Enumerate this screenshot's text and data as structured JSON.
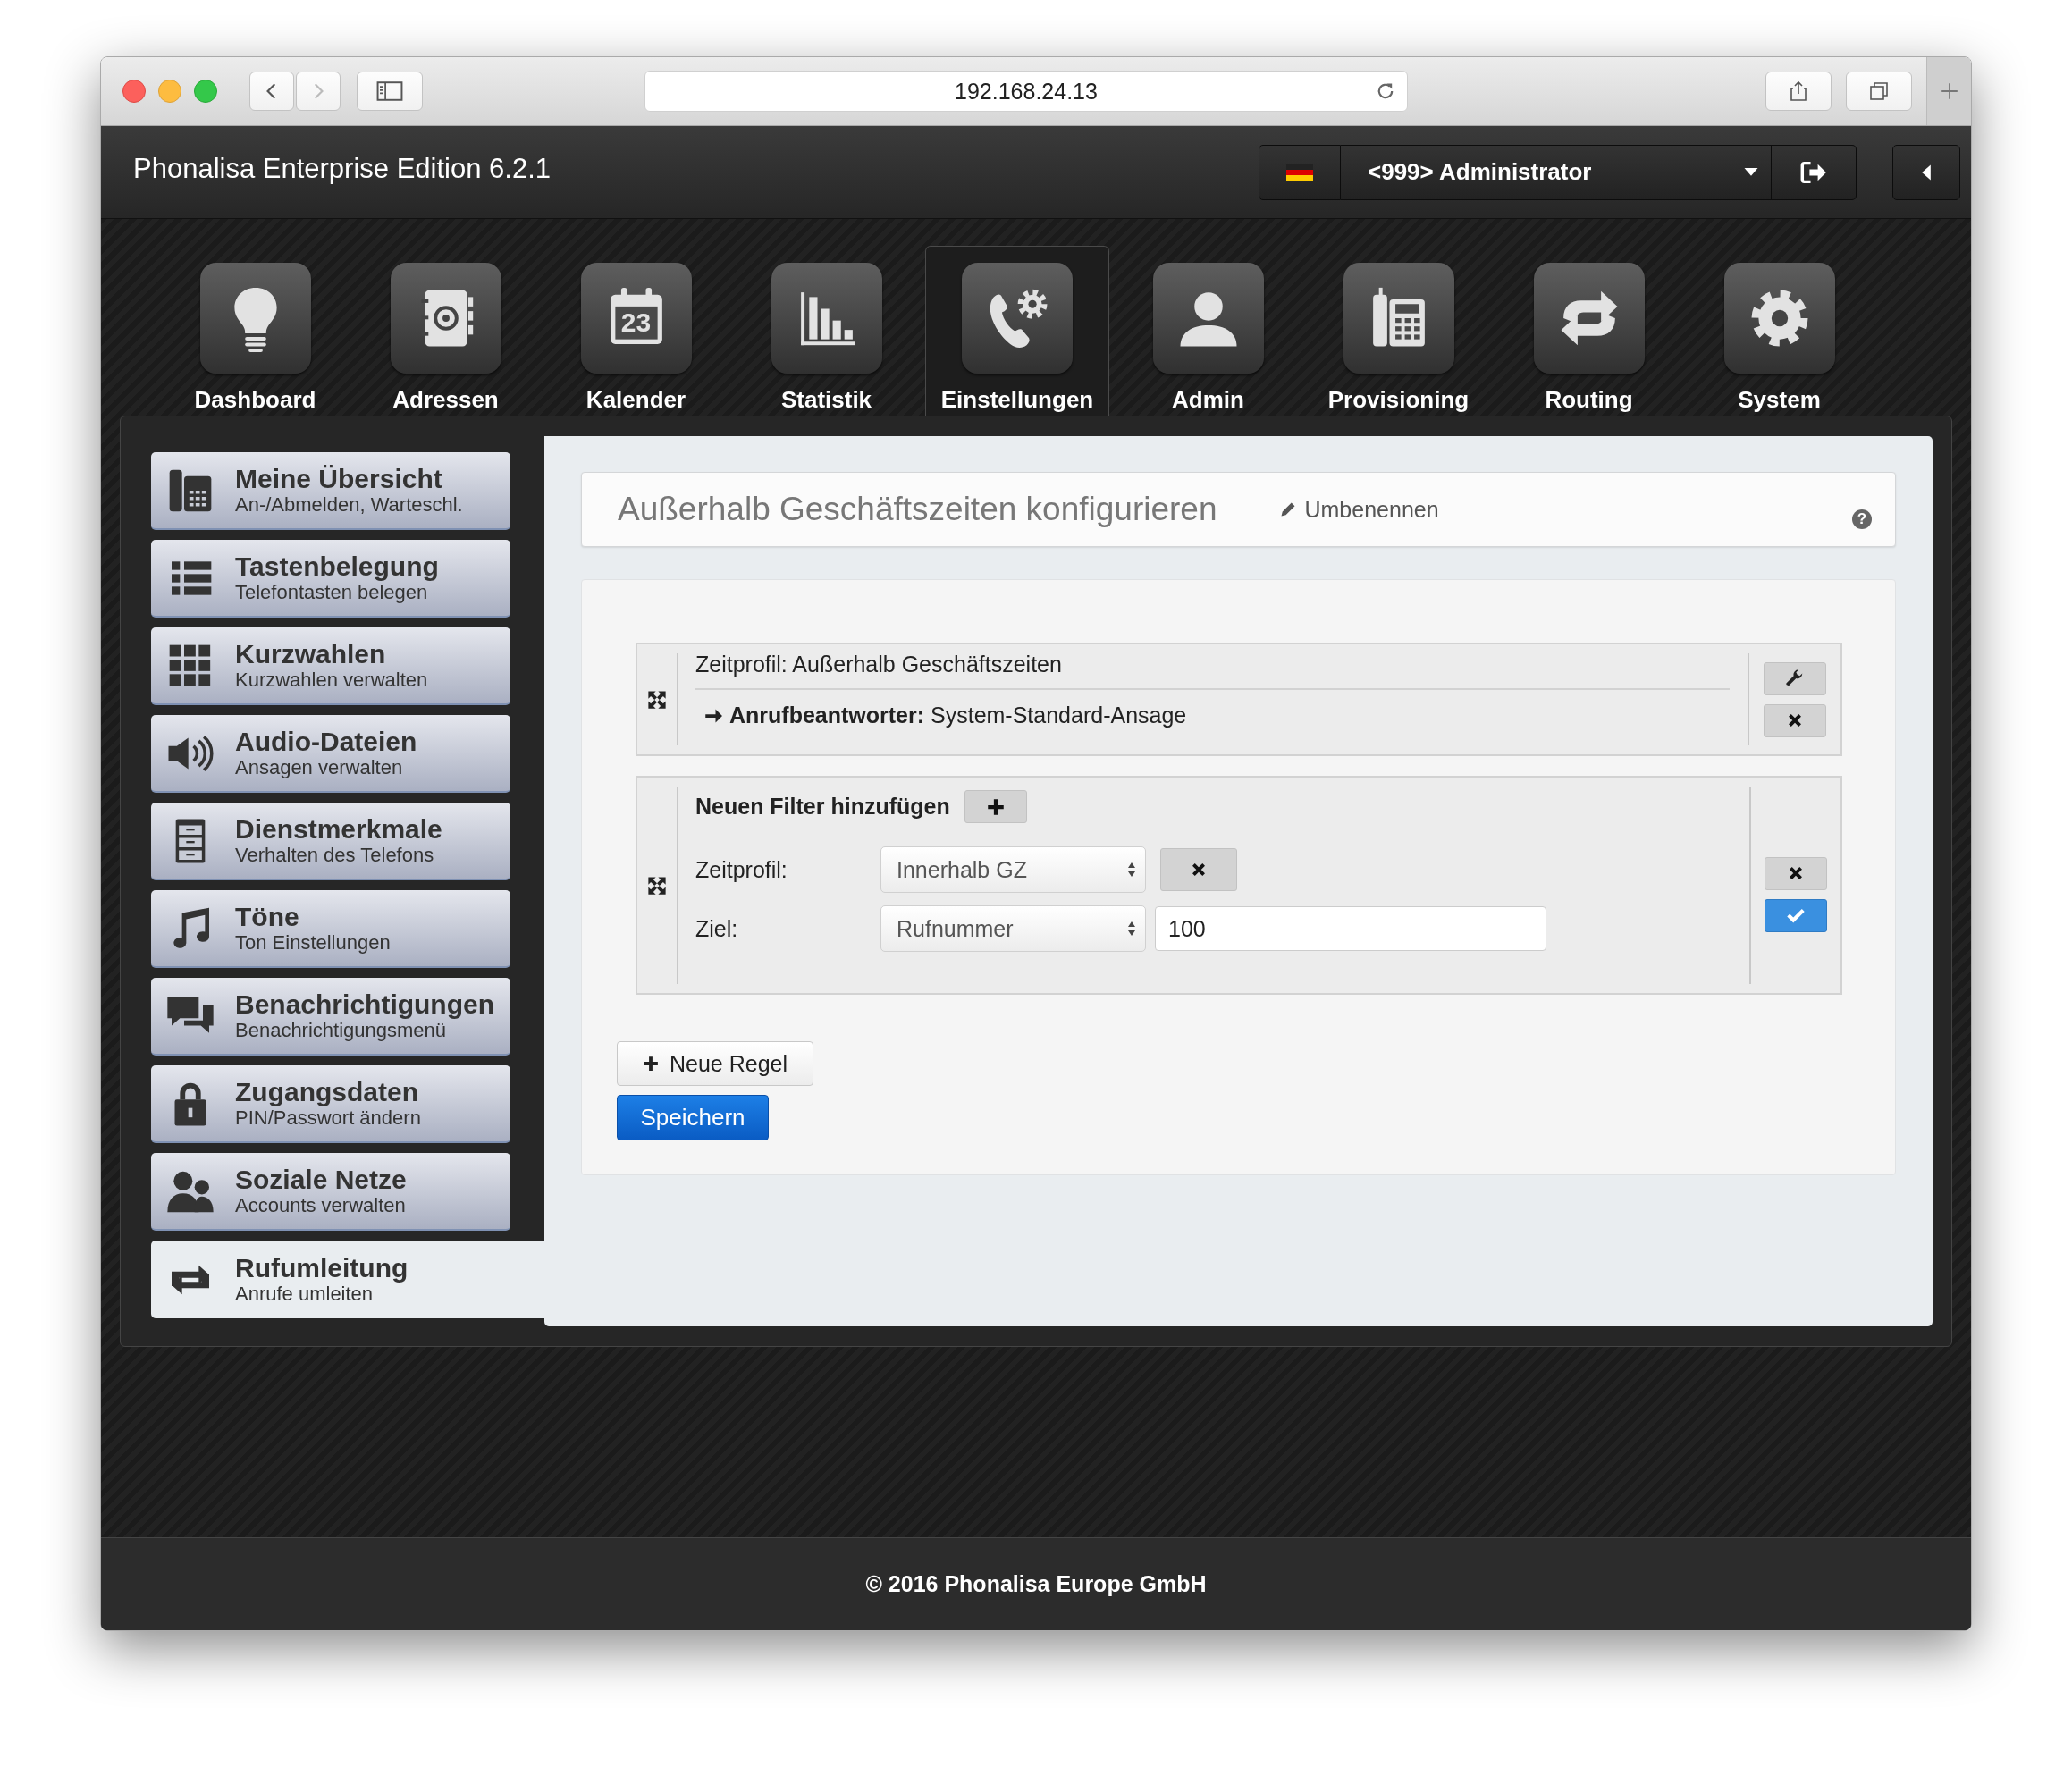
{
  "browser": {
    "url": "192.168.24.13"
  },
  "header": {
    "title": "Phonalisa Enterprise Edition 6.2.1",
    "user": "<999> Administrator"
  },
  "nav": [
    {
      "label": "Dashboard",
      "selected": false
    },
    {
      "label": "Adressen",
      "selected": false
    },
    {
      "label": "Kalender",
      "selected": false,
      "icon_text": "23"
    },
    {
      "label": "Statistik",
      "selected": false
    },
    {
      "label": "Einstellungen",
      "selected": true
    },
    {
      "label": "Admin",
      "selected": false
    },
    {
      "label": "Provisioning",
      "selected": false
    },
    {
      "label": "Routing",
      "selected": false
    },
    {
      "label": "System",
      "selected": false
    }
  ],
  "sidebar": [
    {
      "title": "Meine Übersicht",
      "subtitle": "An-/Abmelden, Warteschl.",
      "selected": false
    },
    {
      "title": "Tastenbelegung",
      "subtitle": "Telefontasten belegen",
      "selected": false
    },
    {
      "title": "Kurzwahlen",
      "subtitle": "Kurzwahlen verwalten",
      "selected": false
    },
    {
      "title": "Audio-Dateien",
      "subtitle": "Ansagen verwalten",
      "selected": false
    },
    {
      "title": "Dienstmerkmale",
      "subtitle": "Verhalten des Telefons",
      "selected": false
    },
    {
      "title": "Töne",
      "subtitle": "Ton Einstellungen",
      "selected": false
    },
    {
      "title": "Benachrichtigungen",
      "subtitle": "Benachrichtigungsmenü",
      "selected": false
    },
    {
      "title": "Zugangsdaten",
      "subtitle": "PIN/Passwort ändern",
      "selected": false
    },
    {
      "title": "Soziale Netze",
      "subtitle": "Accounts verwalten",
      "selected": false
    },
    {
      "title": "Rufumleitung",
      "subtitle": "Anrufe umleiten",
      "selected": true
    }
  ],
  "panel": {
    "title": "Außerhalb Geschäftszeiten konfigurieren",
    "rename": "Umbenennen",
    "help": "?"
  },
  "rule": {
    "profile": "Zeitprofil: Außerhalb Geschäftszeiten",
    "action": "**Anrufbeantworter:** System-Standard-Ansage"
  },
  "filter": {
    "title": "Neuen Filter hinzufügen",
    "fields": [
      {
        "kind": "select_remove",
        "label": "Zeitprofil:",
        "select": "Innerhalb GZ"
      },
      {
        "kind": "select_input",
        "label": "Ziel:",
        "select": "Rufnummer",
        "value": "100"
      }
    ]
  },
  "buttons": {
    "new_rule": "Neue Regel",
    "save": "Speichern"
  },
  "footer": "© 2016 Phonalisa Europe GmbH"
}
